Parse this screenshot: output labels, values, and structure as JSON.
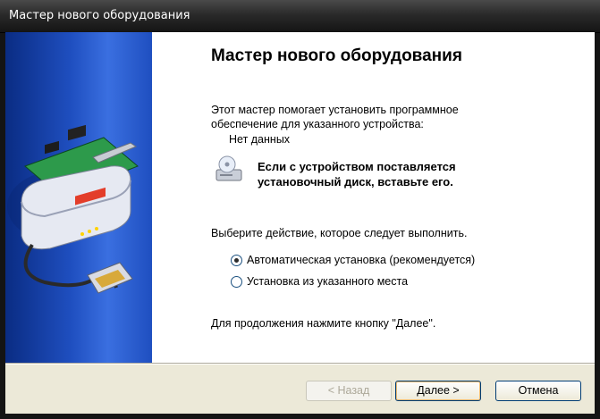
{
  "window": {
    "title": "Мастер нового оборудования"
  },
  "content": {
    "heading": "Мастер нового оборудования",
    "intro_line1": "Этот мастер помогает установить программное",
    "intro_line2": "обеспечение для указанного устройства:",
    "device_name": "Нет данных",
    "cd_line1": "Если с устройством поставляется",
    "cd_line2": "установочный диск, вставьте его.",
    "prompt": "Выберите действие, которое следует выполнить.",
    "options": [
      {
        "label": "Автоматическая установка (рекомендуется)",
        "selected": true
      },
      {
        "label": "Установка из указанного места",
        "selected": false
      }
    ],
    "continue_text": "Для продолжения нажмите кнопку \"Далее\"."
  },
  "buttons": {
    "back": "< Назад",
    "next": "Далее >",
    "cancel": "Отмена"
  },
  "icons": {
    "sidebar": "hardware-card-icon",
    "cd": "cd-drive-icon"
  }
}
